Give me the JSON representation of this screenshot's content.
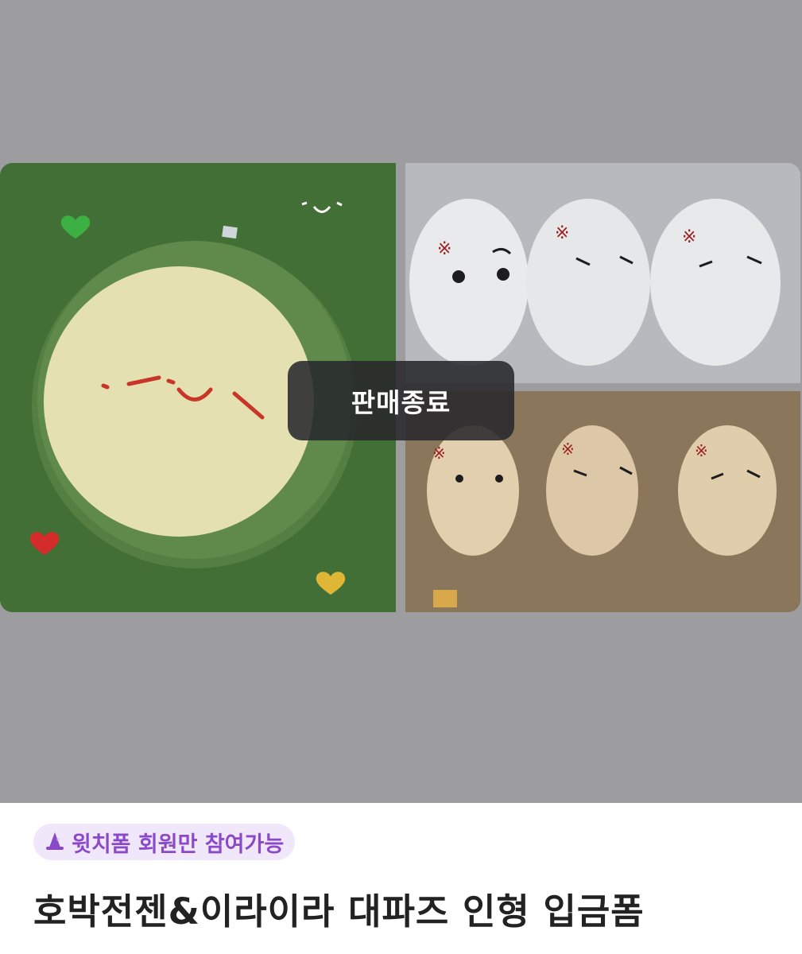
{
  "status_overlay": {
    "label": "판매종료"
  },
  "badge": {
    "label": "윗치폼 회원만 참여가능",
    "icon": "witch-hat-icon"
  },
  "product": {
    "title": "호박전젠&이라이라 대파즈 인형 입금폼"
  },
  "colors": {
    "overlay_bg": "#28282c",
    "badge_bg": "#f1e7fa",
    "badge_text": "#8a49c9",
    "title_text": "#222222"
  }
}
